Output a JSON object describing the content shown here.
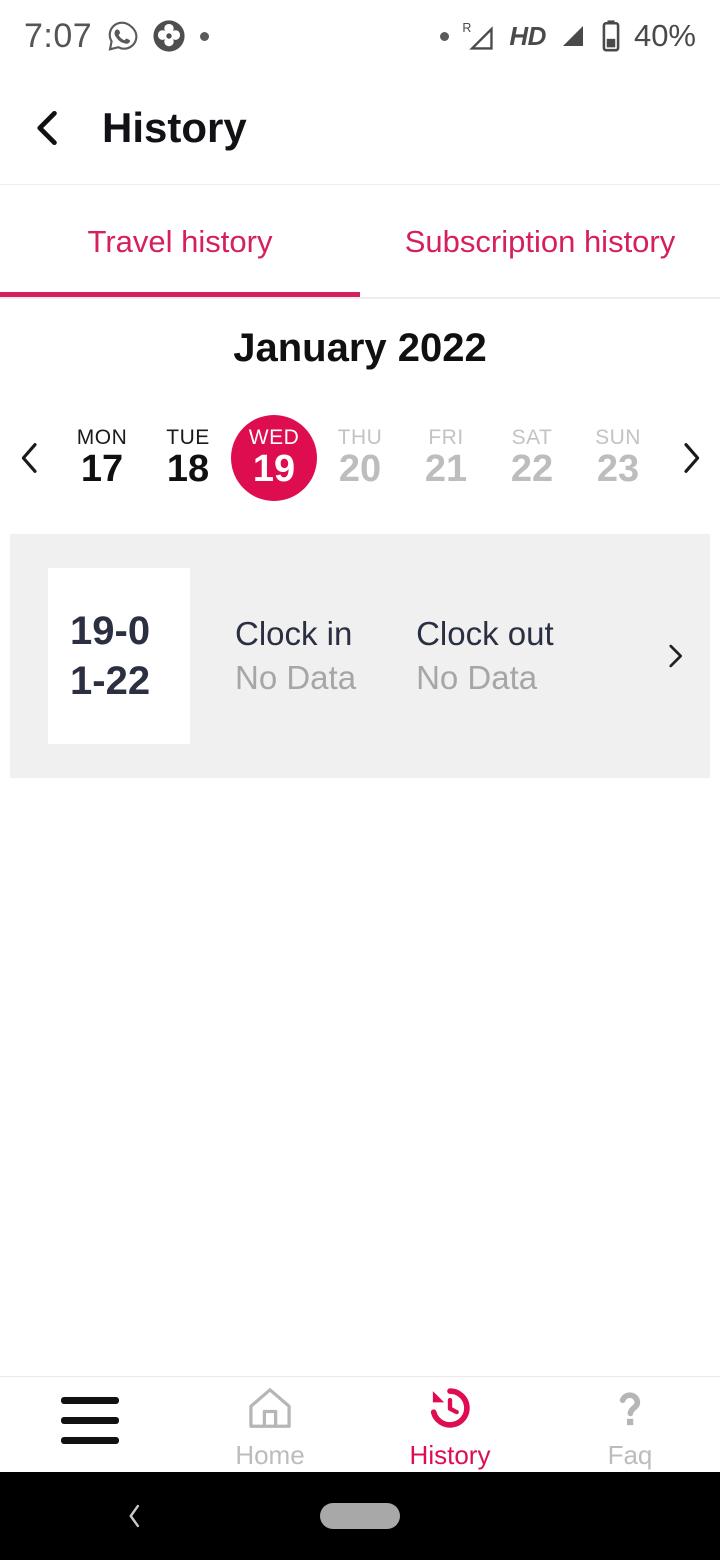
{
  "status_bar": {
    "time": "7:07",
    "left_icons": [
      "whatsapp-icon",
      "clover-icon",
      "dot-icon"
    ],
    "right_icons": [
      "dot-icon",
      "roaming-signal-icon",
      "hd-icon",
      "signal-icon",
      "battery-icon"
    ],
    "roaming_label": "R",
    "hd_label": "HD",
    "battery_percent": "40%"
  },
  "app_bar": {
    "back_icon": "chevron-left-icon",
    "title": "History"
  },
  "tabs": {
    "items": [
      {
        "label": "Travel history",
        "active": true
      },
      {
        "label": "Subscription history",
        "active": false
      }
    ]
  },
  "calendar": {
    "month_title": "January 2022",
    "prev_icon": "chevron-left-icon",
    "next_icon": "chevron-right-icon",
    "days": [
      {
        "dow": "MON",
        "num": "17",
        "state": "normal"
      },
      {
        "dow": "TUE",
        "num": "18",
        "state": "normal"
      },
      {
        "dow": "WED",
        "num": "19",
        "state": "selected"
      },
      {
        "dow": "THU",
        "num": "20",
        "state": "muted"
      },
      {
        "dow": "FRI",
        "num": "21",
        "state": "muted"
      },
      {
        "dow": "SAT",
        "num": "22",
        "state": "muted"
      },
      {
        "dow": "SUN",
        "num": "23",
        "state": "muted"
      }
    ]
  },
  "history_card": {
    "date": "19-01-22",
    "clock_in_label": "Clock in",
    "clock_in_value": "No Data",
    "clock_out_label": "Clock out",
    "clock_out_value": "No Data",
    "chevron_icon": "chevron-right-icon"
  },
  "bottom_nav": {
    "items": [
      {
        "label": "",
        "icon": "hamburger-menu-icon",
        "active": false
      },
      {
        "label": "Home",
        "icon": "home-icon",
        "active": false
      },
      {
        "label": "History",
        "icon": "history-clock-icon",
        "active": true
      },
      {
        "label": "Faq",
        "icon": "question-mark-icon",
        "active": false
      }
    ]
  },
  "gesture_bar": {
    "back_icon": "chevron-left-icon",
    "home_pill": "home-pill-handle"
  },
  "colors": {
    "accent": "#dd0d4f",
    "tab_accent": "#d5205c",
    "card_bg": "#f0f0f0",
    "muted_text": "#bdbdbd",
    "dark_text": "#2b2f42"
  }
}
